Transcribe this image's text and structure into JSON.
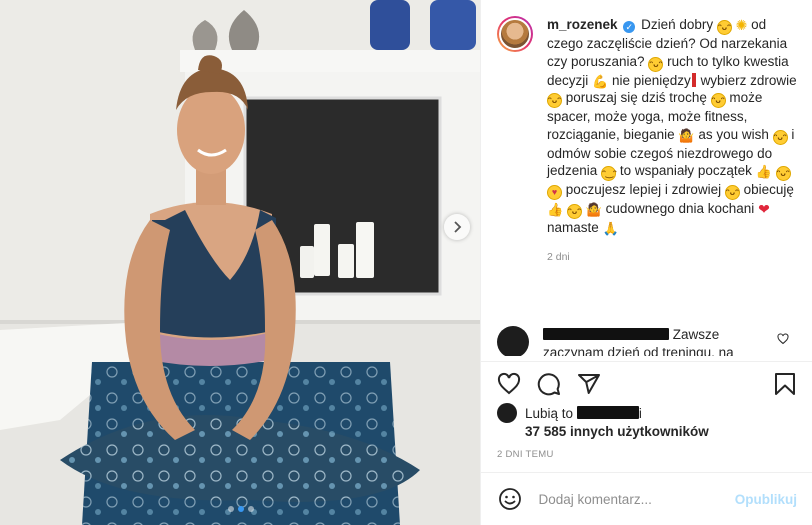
{
  "post": {
    "username": "m_rozenek",
    "verified_icon": "verified-badge-icon",
    "caption_parts": [
      "Dzień dobry",
      "od czego zaczęliście dzień? Od narzekania czy poruszania?",
      "ruch to tylko kwestia decyzji",
      "nie pieniędzy",
      "wybierz zdrowie",
      "poruszaj się dziś trochę",
      "może spacer, może yoga, może fitness, rozciąganie, bieganie",
      "as you wish",
      "i odmów sobie czegoś niezdrowego do jedzenia",
      "to wspaniały początek",
      "poczujesz lepiej i zdrowiej",
      "obiecuję",
      "cudownego dnia kochani",
      "namaste"
    ],
    "caption_time": "2 dni"
  },
  "comment": {
    "text": "Zawsze zaczynam dzień od treningu, na"
  },
  "likes": {
    "prefix": "Lubią to",
    "suffix": "i",
    "count": "37 585 innych użytkowników"
  },
  "time_upper": "2 DNI TEMU",
  "comment_box": {
    "placeholder": "Dodaj komentarz...",
    "post_label": "Opublikuj"
  },
  "carousel": {
    "slides": 3,
    "active_index": 1
  },
  "colors": {
    "accent": "#3897f0",
    "post_button": "#b2dffc",
    "muted_text": "#8e8e8e"
  },
  "icons": [
    "heart-icon",
    "comment-icon",
    "share-icon",
    "bookmark-icon",
    "emoji-icon",
    "chevron-right-icon"
  ]
}
